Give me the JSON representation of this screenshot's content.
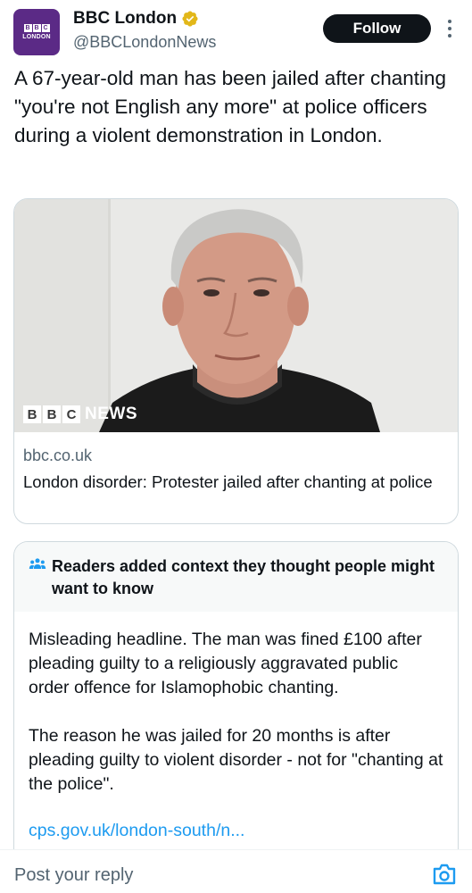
{
  "account": {
    "name": "BBC London",
    "handle": "@BBCLondonNews",
    "avatar_text": "LONDON",
    "avatar_blocks": [
      "B",
      "B",
      "C"
    ]
  },
  "follow_label": "Follow",
  "tweet": {
    "text": "A 67-year-old man has been jailed after chanting \"you're not English any more\" at police officers during a violent demonstration in London."
  },
  "card": {
    "watermark_blocks": [
      "B",
      "B",
      "C"
    ],
    "watermark_word": "NEWS",
    "domain": "bbc.co.uk",
    "title": "London disorder: Protester jailed after chanting at police"
  },
  "community_note": {
    "title": "Readers added context they thought people might want to know",
    "paragraphs": [
      "Misleading headline. The man was fined £100 after pleading guilty to a religiously aggravated public order offence for Islamophobic chanting.",
      "The reason he was jailed for 20 months is after pleading guilty to violent disorder - not for \"chanting at the police\"."
    ],
    "link": "cps.gov.uk/london-south/n..."
  },
  "reply": {
    "placeholder": "Post your reply"
  },
  "icons": {
    "verified": "verified-badge-icon",
    "more": "more-options-icon",
    "people": "people-icon",
    "camera": "camera-icon"
  },
  "colors": {
    "accent": "#1d9bf0",
    "avatar_bg": "#5b2a86",
    "verified_gold": "#e2b719",
    "follow_bg": "#0f1419"
  }
}
